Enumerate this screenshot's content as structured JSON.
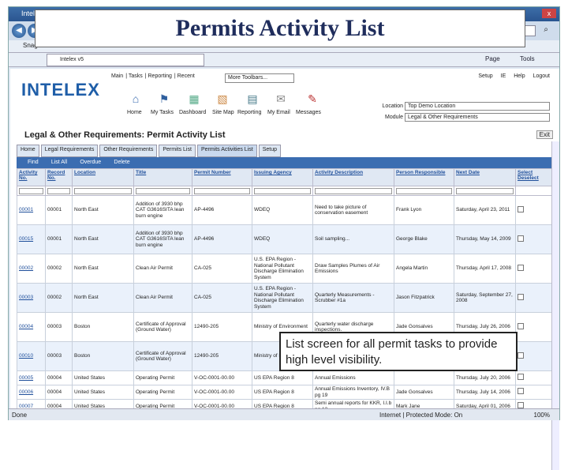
{
  "browser": {
    "app_name": "Intelex",
    "close": "x",
    "tab_title": "Intelex v5",
    "snagit": "SnagIt",
    "commands": [
      "Page",
      "Tools"
    ],
    "search_glyph": "⌕"
  },
  "slide_title": "Permits Activity List",
  "app": {
    "logo": "INTELEX",
    "top_nav": [
      "Main",
      "Tasks",
      "Reporting",
      "Recent"
    ],
    "toolbar_select": "More Toolbars...",
    "right_nav": [
      "Setup",
      "IE",
      "Help",
      "Logout"
    ],
    "modules": [
      {
        "icon": "⌂",
        "label": "Home"
      },
      {
        "icon": "⚑",
        "label": "My Tasks"
      },
      {
        "icon": "▦",
        "label": "Dashboard"
      },
      {
        "icon": "▧",
        "label": "Site Map"
      },
      {
        "icon": "▤",
        "label": "Reporting"
      },
      {
        "icon": "✉",
        "label": "My Email"
      },
      {
        "icon": "✎",
        "label": "Messages"
      }
    ],
    "location_label": "Location",
    "location_value": "Top Demo Location",
    "module_label": "Module",
    "module_value": "Legal & Other Requirements",
    "page_title": "Legal & Other Requirements:  Permit Activity List",
    "exit": "Exit",
    "tabs": [
      "Home",
      "Legal Requirements",
      "Other Requirements",
      "Permits List",
      "Permits Activities List",
      "Setup"
    ],
    "active_tab": "Permits Activities List",
    "sub_actions": [
      "Find",
      "List All",
      "Overdue",
      "Delete"
    ]
  },
  "table": {
    "headers": [
      "Activity No.",
      "Record No.",
      "Location",
      "Title",
      "Permit Number",
      "Issuing Agency",
      "Activity Description",
      "Person Responsible",
      "Next Date",
      "Select Deselect"
    ],
    "rows": [
      [
        "00001",
        "00001",
        "North East",
        "Addition of 3930 bhp CAT G3616SITA lean burn engine",
        "AP-4496",
        "WDEQ",
        "Need to take picture of conservation easement",
        "Frank Lyon",
        "Saturday, April 23, 2011"
      ],
      [
        "00015",
        "00001",
        "North East",
        "Addition of 3930 bhp CAT G3616SITA lean burn engine",
        "AP-4496",
        "WDEQ",
        "Soil sampling...",
        "George Blake",
        "Thursday, May 14, 2009"
      ],
      [
        "00002",
        "00002",
        "North East",
        "Clean Air Permit",
        "CA-025",
        "U.S. EPA Region - National Pollutant Discharge Elimination System",
        "Draw Samples Plumes of Air Emissions",
        "Angela Martin",
        "Thursday, April 17, 2008"
      ],
      [
        "00003",
        "00002",
        "North East",
        "Clean Air Permit",
        "CA-025",
        "U.S. EPA Region - National Pollutant Discharge Elimination System",
        "Quarterly Measurements - Scrubber #1a",
        "Jason Fitzpatrick",
        "Saturday, September 27, 2008"
      ],
      [
        "00004",
        "00003",
        "Boston",
        "Certificate of Approval (Ground Water)",
        "12490-205",
        "Ministry of Environment",
        "Quarterly water discharge inspections.",
        "Jade Gonsalves",
        "Thursday, July 26, 2006"
      ],
      [
        "00010",
        "00003",
        "Boston",
        "Certificate of Approval (Ground Water)",
        "12490-205",
        "Ministry of Environment",
        "",
        "",
        ""
      ],
      [
        "00005",
        "00004",
        "United States",
        "Operating Permit",
        "V-OC-0001-00.00",
        "US EPA Region 8",
        "Annual Emissions",
        "",
        "Thursday, July 20, 2006"
      ],
      [
        "00006",
        "00004",
        "United States",
        "Operating Permit",
        "V-OC-0001-00.00",
        "US EPA Region 8",
        "Annual Emissions Inventory, IV.B pg 19",
        "Jade Gonsalves",
        "Thursday, July 14, 2006"
      ],
      [
        "00007",
        "00004",
        "United States",
        "Operating Permit",
        "V-OC-0001-00.00",
        "US EPA Region 8",
        "Semi annual reports for KKR, I.I.b pg 13",
        "Mark Jane",
        "Saturday, April 01, 2006"
      ]
    ]
  },
  "callout": "List screen for all permit tasks to provide high level visibility.",
  "status": {
    "left": "Done",
    "zone": "Internet | Protected Mode: On",
    "zoom": "100%"
  }
}
